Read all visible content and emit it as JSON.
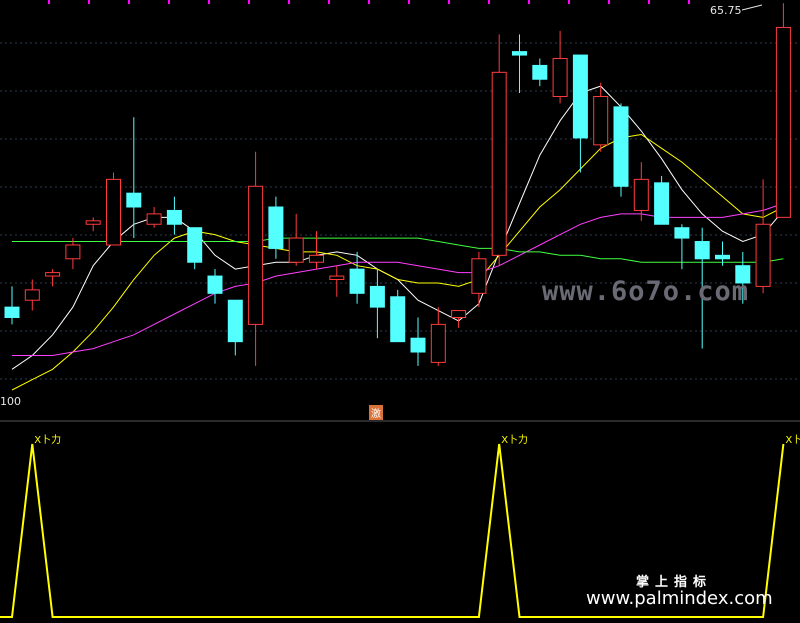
{
  "chart_data": [
    {
      "type": "candlestick",
      "ylim": [
        10.0,
        65.75
      ],
      "price_label": "65.75",
      "bottom_label": "100",
      "candles": [
        {
          "o": 22.0,
          "h": 25.0,
          "l": 19.5,
          "c": 20.5
        },
        {
          "o": 23.0,
          "h": 26.0,
          "l": 21.5,
          "c": 24.5
        },
        {
          "o": 26.5,
          "h": 27.5,
          "l": 25.0,
          "c": 27.0
        },
        {
          "o": 29.0,
          "h": 32.0,
          "l": 27.5,
          "c": 31.0
        },
        {
          "o": 34.0,
          "h": 35.0,
          "l": 33.0,
          "c": 34.5
        },
        {
          "o": 31.0,
          "h": 41.5,
          "l": 31.0,
          "c": 40.5
        },
        {
          "o": 38.5,
          "h": 49.5,
          "l": 32.0,
          "c": 36.5
        },
        {
          "o": 34.0,
          "h": 36.5,
          "l": 33.5,
          "c": 35.5
        },
        {
          "o": 36.0,
          "h": 38.0,
          "l": 32.5,
          "c": 34.0
        },
        {
          "o": 33.5,
          "h": 33.5,
          "l": 27.5,
          "c": 28.5
        },
        {
          "o": 26.5,
          "h": 27.5,
          "l": 22.5,
          "c": 24.0
        },
        {
          "o": 23.0,
          "h": 23.0,
          "l": 15.0,
          "c": 17.0
        },
        {
          "o": 19.5,
          "h": 44.5,
          "l": 13.5,
          "c": 39.5
        },
        {
          "o": 36.5,
          "h": 38.0,
          "l": 29.0,
          "c": 30.5
        },
        {
          "o": 28.5,
          "h": 35.5,
          "l": 28.0,
          "c": 32.0
        },
        {
          "o": 28.5,
          "h": 33.0,
          "l": 27.5,
          "c": 29.5
        },
        {
          "o": 26.0,
          "h": 28.0,
          "l": 23.5,
          "c": 26.5
        },
        {
          "o": 27.5,
          "h": 30.0,
          "l": 22.5,
          "c": 24.0
        },
        {
          "o": 25.0,
          "h": 27.5,
          "l": 17.5,
          "c": 22.0
        },
        {
          "o": 23.5,
          "h": 24.5,
          "l": 21.0,
          "c": 17.0
        },
        {
          "o": 17.5,
          "h": 20.5,
          "l": 13.5,
          "c": 15.5
        },
        {
          "o": 14.0,
          "h": 22.0,
          "l": 13.5,
          "c": 19.5
        },
        {
          "o": 20.5,
          "h": 21.5,
          "l": 19.0,
          "c": 21.5
        },
        {
          "o": 24.0,
          "h": 30.0,
          "l": 22.0,
          "c": 29.0
        },
        {
          "o": 29.5,
          "h": 61.5,
          "l": 28.0,
          "c": 56.0
        },
        {
          "o": 59.0,
          "h": 61.5,
          "l": 53.0,
          "c": 58.5
        },
        {
          "o": 57.0,
          "h": 58.0,
          "l": 54.0,
          "c": 55.0
        },
        {
          "o": 52.5,
          "h": 62.0,
          "l": 51.5,
          "c": 58.0
        },
        {
          "o": 58.5,
          "h": 58.5,
          "l": 41.5,
          "c": 46.5
        },
        {
          "o": 45.5,
          "h": 54.5,
          "l": 44.5,
          "c": 52.5
        },
        {
          "o": 51.0,
          "h": 51.5,
          "l": 38.0,
          "c": 39.5
        },
        {
          "o": 36.0,
          "h": 43.0,
          "l": 34.5,
          "c": 40.5
        },
        {
          "o": 40.0,
          "h": 41.0,
          "l": 34.0,
          "c": 34.0
        },
        {
          "o": 33.5,
          "h": 34.0,
          "l": 27.5,
          "c": 32.0
        },
        {
          "o": 31.5,
          "h": 33.5,
          "l": 16.0,
          "c": 29.0
        },
        {
          "o": 29.5,
          "h": 31.5,
          "l": 28.0,
          "c": 29.0
        },
        {
          "o": 28.0,
          "h": 30.0,
          "l": 22.5,
          "c": 25.5
        },
        {
          "o": 25.0,
          "h": 40.5,
          "l": 24.0,
          "c": 34.0
        },
        {
          "o": 35.0,
          "h": 66.0,
          "l": 35.0,
          "c": 62.5
        }
      ],
      "ma": [
        {
          "name": "",
          "color": "#ffffff",
          "values": [
            13.0,
            15.0,
            18.0,
            22.0,
            28.0,
            31.5,
            34.0,
            35.0,
            35.0,
            33.0,
            29.5,
            27.5,
            28.0,
            28.5,
            28.5,
            29.5,
            30.0,
            29.5,
            27.5,
            26.0,
            23.0,
            21.5,
            20.0,
            22.5,
            30.0,
            37.0,
            44.0,
            49.0,
            53.0,
            54.0,
            51.0,
            47.5,
            43.5,
            39.0,
            35.5,
            33.0,
            31.5,
            32.5,
            36.0
          ]
        },
        {
          "name": "",
          "color": "#ffff00",
          "values": [
            10.0,
            11.5,
            13.0,
            15.5,
            18.5,
            22.0,
            26.0,
            29.5,
            32.0,
            33.0,
            32.5,
            31.5,
            31.0,
            30.5,
            30.0,
            30.0,
            29.5,
            28.0,
            27.5,
            26.0,
            25.5,
            25.5,
            25.0,
            26.0,
            29.5,
            33.0,
            36.5,
            39.0,
            42.0,
            45.0,
            46.5,
            47.0,
            45.0,
            43.0,
            40.5,
            38.0,
            35.5,
            35.0,
            36.5
          ]
        },
        {
          "name": "",
          "color": "#ff40ff",
          "values": [
            15.0,
            15.0,
            15.0,
            15.5,
            16.0,
            17.0,
            18.0,
            19.5,
            21.0,
            22.5,
            24.0,
            25.0,
            25.5,
            26.5,
            27.0,
            27.5,
            28.0,
            28.5,
            28.5,
            28.5,
            28.0,
            27.5,
            27.0,
            27.0,
            28.0,
            29.5,
            31.0,
            32.5,
            34.0,
            35.0,
            35.5,
            35.5,
            35.0,
            35.0,
            35.0,
            35.0,
            35.5,
            36.0,
            37.0
          ]
        },
        {
          "name": "",
          "color": "#40ff40",
          "values": [
            31.5,
            31.5,
            31.5,
            31.5,
            31.5,
            31.5,
            31.5,
            31.5,
            31.5,
            31.5,
            31.5,
            31.5,
            31.5,
            32.0,
            32.0,
            32.0,
            32.0,
            32.0,
            32.0,
            32.0,
            32.0,
            31.5,
            31.0,
            30.5,
            30.5,
            30.0,
            30.0,
            29.5,
            29.5,
            29.0,
            29.0,
            28.5,
            28.5,
            28.5,
            28.5,
            28.5,
            28.5,
            28.5,
            29.0
          ]
        }
      ],
      "top_marks": 17,
      "signal_tag": "激"
    },
    {
      "type": "line",
      "ylim": [
        0,
        1
      ],
      "color": "#ffff00",
      "peaks": [
        1,
        24,
        38
      ],
      "signal_text": "X卜力",
      "values": [
        0,
        1,
        0,
        0,
        0,
        0,
        0,
        0,
        0,
        0,
        0,
        0,
        0,
        0,
        0,
        0,
        0,
        0,
        0,
        0,
        0,
        0,
        0,
        0,
        1,
        0,
        0,
        0,
        0,
        0,
        0,
        0,
        0,
        0,
        0,
        0,
        0,
        0,
        1
      ]
    }
  ],
  "watermarks": {
    "site": "www.6o7o.com",
    "brand_cn": "掌上指标",
    "site2": "www.palmindex.com"
  }
}
